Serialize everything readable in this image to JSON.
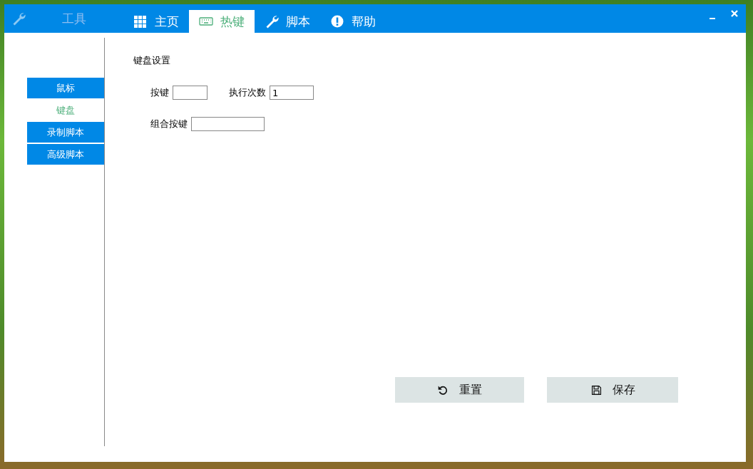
{
  "app": {
    "title": "工具"
  },
  "tabs": [
    {
      "label": "主页",
      "selected": false
    },
    {
      "label": "热键",
      "selected": true
    },
    {
      "label": "脚本",
      "selected": false
    },
    {
      "label": "帮助",
      "selected": false
    }
  ],
  "sidebar": {
    "items": [
      {
        "label": "鼠标",
        "selected": false
      },
      {
        "label": "键盘",
        "selected": true
      },
      {
        "label": "录制脚本",
        "selected": false
      },
      {
        "label": "高级脚本",
        "selected": false
      }
    ]
  },
  "section": {
    "title": "键盘设置"
  },
  "fields": [
    {
      "label": "按键"
    },
    {
      "label": "执行次数",
      "value": "1"
    },
    {
      "label": "组合按键"
    }
  ],
  "buttons": [
    {
      "label": "重置"
    },
    {
      "label": "保存"
    }
  ]
}
